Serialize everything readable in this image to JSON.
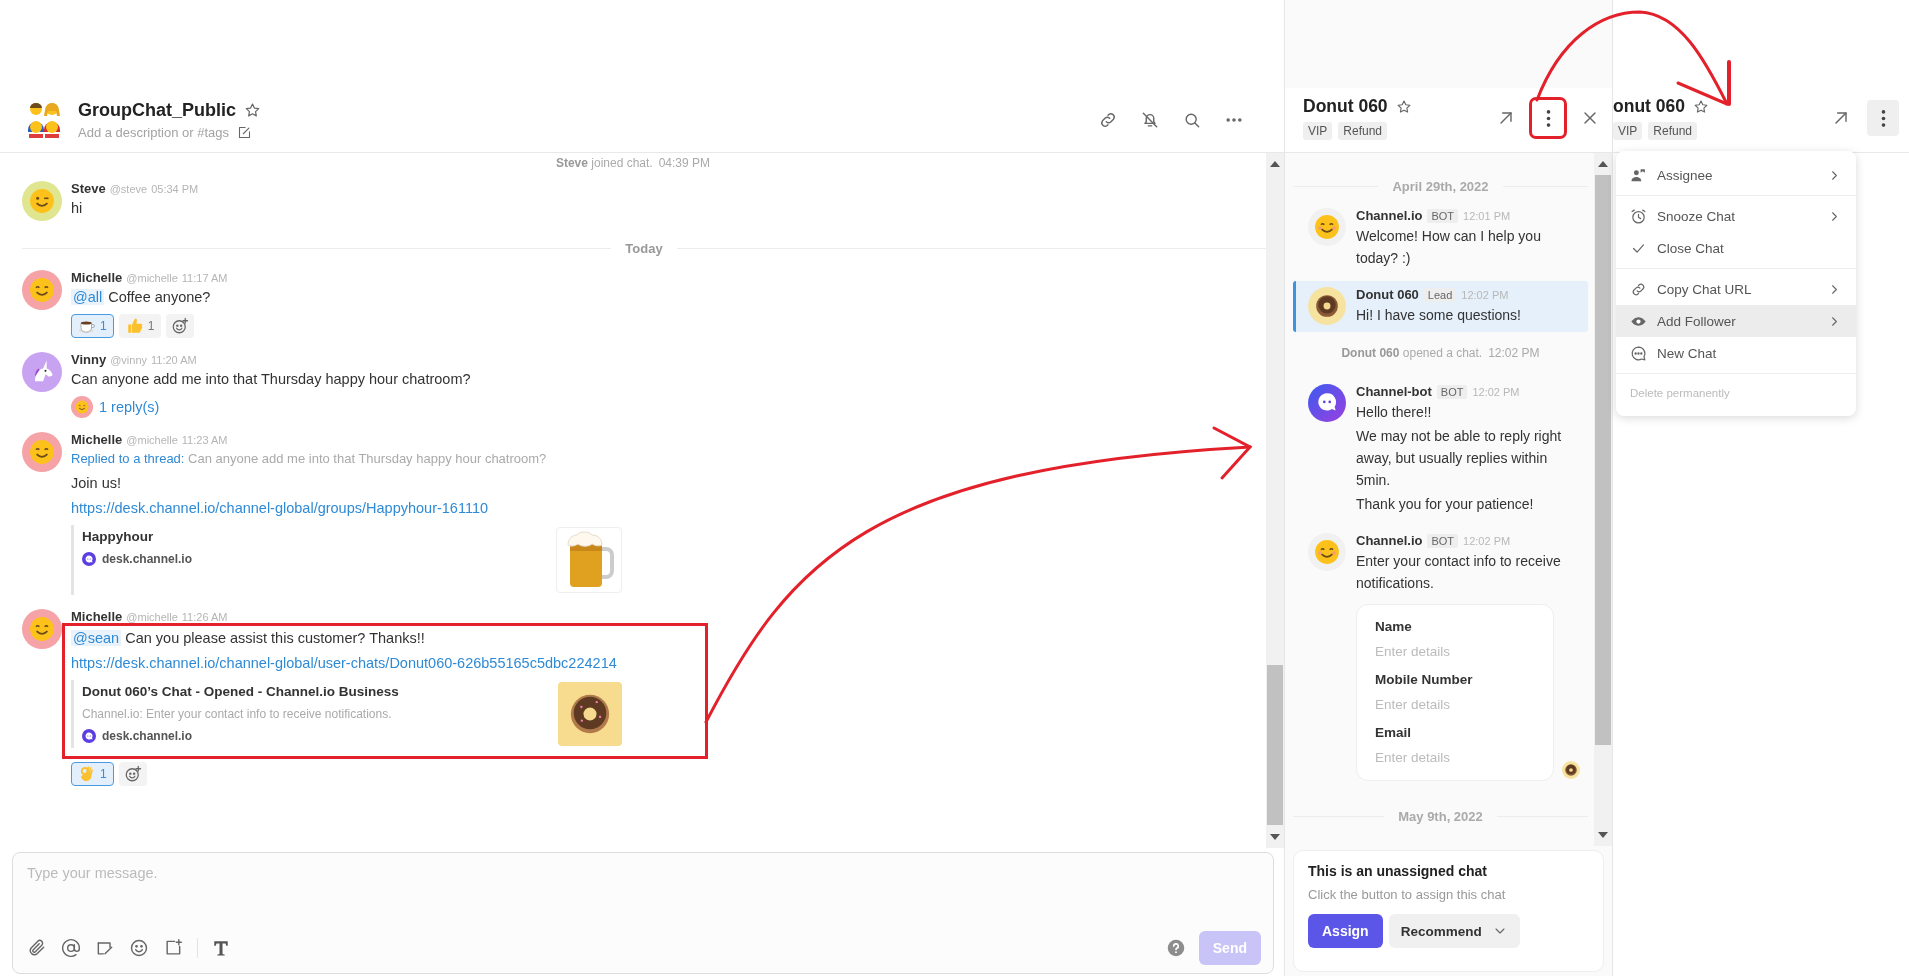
{
  "main_chat": {
    "title": "GroupChat_Public",
    "description": "Add a description or #tags",
    "items": [
      {
        "kind": "system",
        "name": "Steve",
        "text": "joined chat.",
        "time": "04:39 PM"
      },
      {
        "kind": "message",
        "avatar": {
          "kind": "wink",
          "color": "#dfe68f"
        },
        "name": "Steve",
        "handle": "@steve",
        "time": "05:34 PM",
        "text": "hi"
      },
      {
        "kind": "date",
        "text": "Today"
      },
      {
        "kind": "message",
        "avatar": {
          "kind": "smile",
          "color": "#f5a3a7"
        },
        "name": "Michelle",
        "handle": "@michelle",
        "time": "11:17 AM",
        "mention": "@all",
        "text": "Coffee anyone?",
        "reactions": [
          {
            "kind": "coffee",
            "count": "1",
            "selected": true
          },
          {
            "kind": "thumbs-up",
            "count": "1",
            "selected": false
          }
        ]
      },
      {
        "kind": "message",
        "avatar": {
          "kind": "unicorn",
          "color": "#c8a3f2"
        },
        "name": "Vinny",
        "handle": "@vinny",
        "time": "11:20 AM",
        "text": "Can anyone add me into that Thursday happy hour chatroom?",
        "replies": "1 reply(s)"
      },
      {
        "kind": "message",
        "avatar": {
          "kind": "smile",
          "color": "#f5a3a7"
        },
        "name": "Michelle",
        "handle": "@michelle",
        "time": "11:23 AM",
        "reply_label": "Replied to a thread:",
        "quote": "Can anyone add me into that Thursday happy hour chatroom?",
        "text": "Join us!",
        "link": "https://desk.channel.io/channel-global/groups/Happyhour-161110",
        "preview": {
          "title": "Happyhour",
          "domain": "desk.channel.io",
          "image": {
            "kind": "beer"
          }
        }
      },
      {
        "kind": "message",
        "avatar": {
          "kind": "smile",
          "color": "#f5a3a7"
        },
        "name": "Michelle",
        "handle": "@michelle",
        "time": "11:26 AM",
        "highlighted": true,
        "mention": "@sean",
        "text": "Can you please assist this customer? Thanks!!",
        "link": "https://desk.channel.io/channel-global/user-chats/Donut060-626b55165c5dbc224214",
        "preview": {
          "title": "Donut 060’s Chat - Opened - Channel.io Business",
          "description": "Channel.io: Enter your contact info to receive notifications.",
          "domain": "desk.channel.io",
          "image": {
            "kind": "donut"
          }
        },
        "reactions": [
          {
            "kind": "ok-hand",
            "count": "1",
            "selected": true
          }
        ]
      }
    ],
    "composer": {
      "placeholder": "Type your message.",
      "send": "Send",
      "send_disabled": true
    }
  },
  "chat_panel": {
    "title": "Donut 060",
    "tags": [
      "VIP",
      "Refund"
    ],
    "more_highlighted": true,
    "items": [
      {
        "kind": "date",
        "text": "April 29th, 2022"
      },
      {
        "kind": "message",
        "avatar": {
          "kind": "blush"
        },
        "name": "Channel.io",
        "badge": "BOT",
        "time": "12:01 PM",
        "lines": [
          "Welcome! How can I help you today? :)"
        ],
        "selected": false
      },
      {
        "kind": "message",
        "avatar": {
          "kind": "donut"
        },
        "name": "Donut 060",
        "badge": "Lead",
        "time": "12:02 PM",
        "lines": [
          "Hi! I have some questions!"
        ],
        "selected": true
      },
      {
        "kind": "system",
        "name": "Donut 060",
        "text": "opened a chat.",
        "time": "12:02 PM"
      },
      {
        "kind": "message",
        "avatar": {
          "kind": "bot"
        },
        "name": "Channel-bot",
        "badge": "BOT",
        "time": "12:02 PM",
        "lines": [
          "Hello there!!",
          "We may not be able to reply right away, but usually replies within 5min.",
          "Thank you for your patience!"
        ],
        "selected": false
      },
      {
        "kind": "message",
        "avatar": {
          "kind": "blush"
        },
        "name": "Channel.io",
        "badge": "BOT",
        "time": "12:02 PM",
        "lines": [
          "Enter your contact info to receive notifications."
        ],
        "selected": false,
        "read_by": {
          "kind": "donut"
        },
        "form": [
          {
            "label": "Name",
            "placeholder": "Enter details"
          },
          {
            "label": "Mobile Number",
            "placeholder": "Enter details"
          },
          {
            "label": "Email",
            "placeholder": "Enter details"
          }
        ]
      },
      {
        "kind": "date",
        "text": "May 9th, 2022"
      }
    ],
    "assign_card": {
      "title": "This is an unassigned chat",
      "text": "Click the button to assign this chat",
      "assign": "Assign",
      "recommend": "Recommend"
    }
  },
  "side_panel": {
    "title": "onut 060",
    "tags": [
      "VIP",
      "Refund"
    ],
    "more_active": true,
    "menu": [
      [
        {
          "kind": "assignee",
          "label": "Assignee",
          "submenu": true,
          "highlighted": false
        }
      ],
      [
        {
          "kind": "snooze",
          "label": "Snooze Chat",
          "submenu": true,
          "highlighted": false
        },
        {
          "kind": "close",
          "label": "Close Chat",
          "submenu": false,
          "highlighted": false
        }
      ],
      [
        {
          "kind": "link",
          "label": "Copy Chat URL",
          "submenu": true,
          "highlighted": false
        },
        {
          "kind": "follower",
          "label": "Add Follower",
          "submenu": true,
          "highlighted": true
        },
        {
          "kind": "new-chat",
          "label": "New Chat",
          "submenu": false,
          "highlighted": false
        }
      ],
      [
        {
          "kind": "delete",
          "label": "Delete permanently",
          "submenu": false,
          "highlighted": false
        }
      ]
    ]
  }
}
